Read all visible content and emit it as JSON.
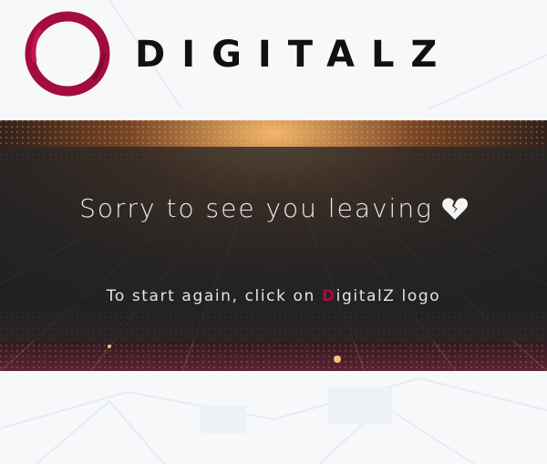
{
  "brand": {
    "name": "DIGITALZ",
    "accent_color": "#a30d3e"
  },
  "message": {
    "headline": "Sorry to see you leaving",
    "headline_icon": "broken-heart-icon",
    "instruction_prefix": "To start again, click on ",
    "instruction_accent": "D",
    "instruction_suffix": "igitalZ logo"
  }
}
